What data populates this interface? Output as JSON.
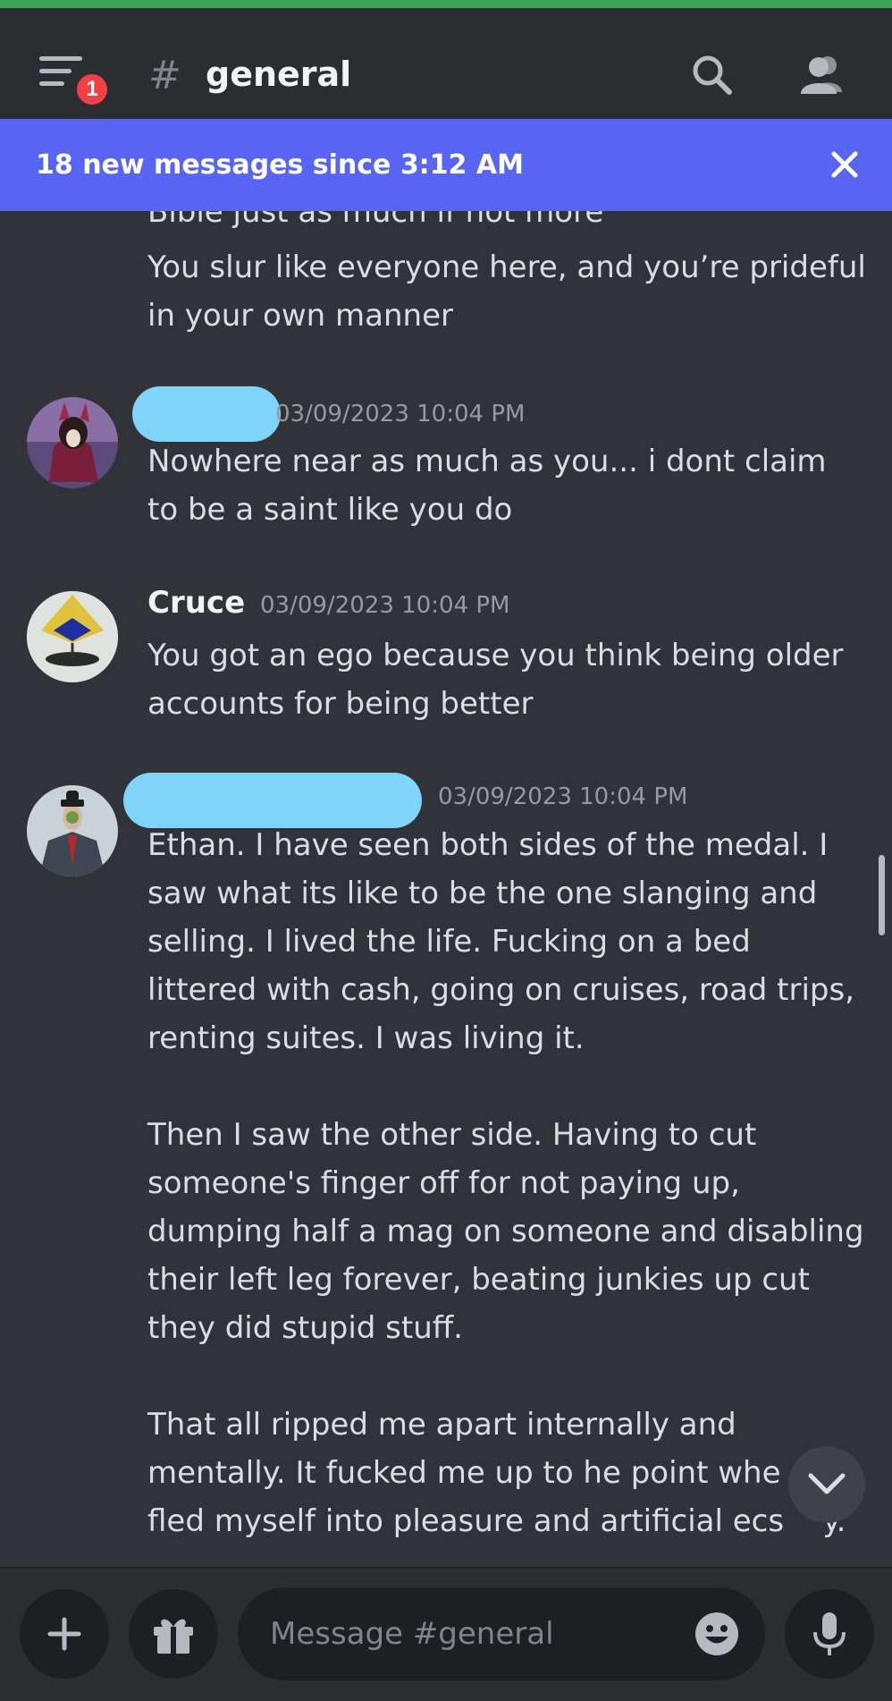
{
  "header": {
    "hash_symbol": "#",
    "channel_name": "general",
    "notification_count": "1"
  },
  "new_messages_bar": {
    "text": "18 new messages since 3:12 AM"
  },
  "messages": {
    "partial_top": "Bible just as much if not more",
    "continuation": "You slur like everyone here, and you’re prideful\nin your own manner",
    "m1": {
      "timestamp": "03/09/2023 10:04 PM",
      "text": "Nowhere near as much as you... i dont claim\nto be a saint like you do"
    },
    "m2": {
      "username": "Cruce",
      "timestamp": "03/09/2023 10:04 PM",
      "text": "You got an ego because you think being older\naccounts for being better"
    },
    "m3": {
      "timestamp": "03/09/2023 10:04 PM",
      "text": "Ethan. I have seen both sides of the medal. I\nsaw what its like to be the one slanging and\nselling. I lived the life. Fucking on a bed\nlittered with cash, going on cruises, road trips,\nrenting suites. I was living it.\n\nThen I saw the other side. Having to cut\nsomeone's finger off for not paying up,\ndumping half a mag on someone and disabling\ntheir left leg forever, beating junkies up cut\nthey did stupid stuff.\n\nThat all ripped me apart internally and\nmentally. It fucked me up to he point whe\nfled myself into pleasure and artificial ecs    y."
    }
  },
  "composer": {
    "placeholder": "Message #general"
  },
  "colors": {
    "background": "#313338",
    "header": "#2b2d31",
    "accent": "#5865f2",
    "badge": "#f23f43",
    "redaction": "#7fd4fa"
  }
}
